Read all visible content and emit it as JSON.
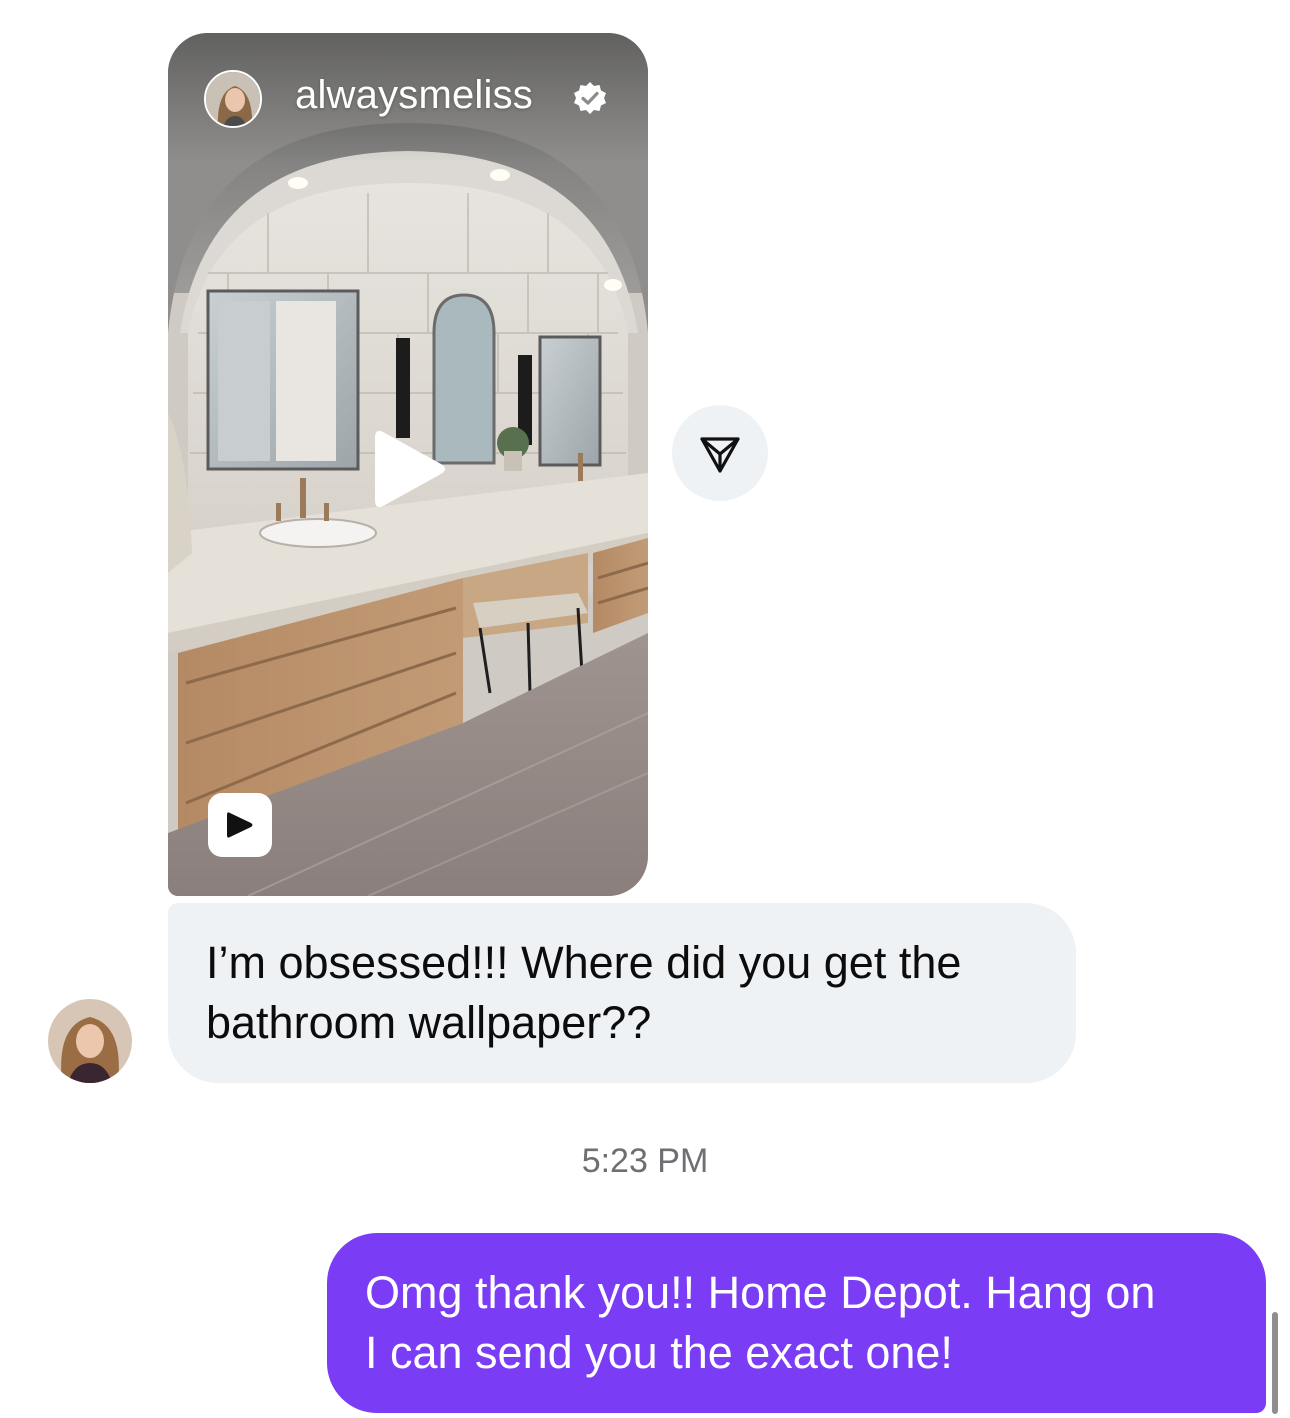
{
  "shared_reel": {
    "username": "alwaysmeliss",
    "verified": true,
    "media_type": "video",
    "icons": {
      "avatar": "profile-photo",
      "verified": "verified-badge-icon",
      "play": "play-icon",
      "reel_badge": "reel-badge-icon"
    }
  },
  "share_button": {
    "icon": "send-paper-plane-icon"
  },
  "received_message": {
    "text": "I’m obsessed!!! Where did you get the\nbathroom wallpaper??"
  },
  "timestamp": "5:23 PM",
  "sent_message": {
    "text": "Omg thank you!! Home Depot. Hang on\nI can send you the exact one!"
  },
  "colors": {
    "received_bubble": "#eff2f5",
    "sent_bubble": "#7a3cf5",
    "timestamp": "#6e6e73"
  }
}
